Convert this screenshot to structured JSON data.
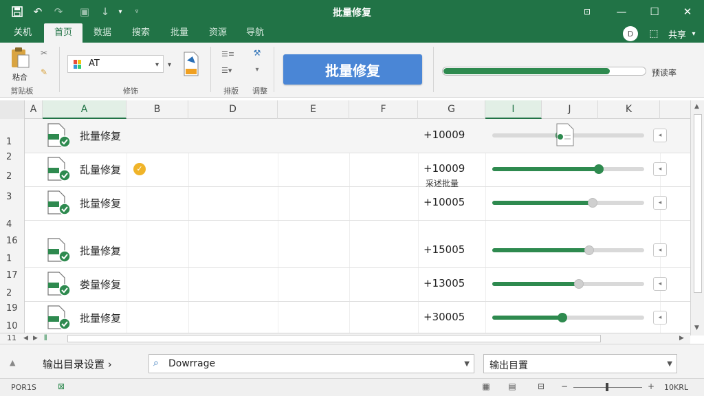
{
  "window": {
    "title": "批量修复"
  },
  "ribbon_tabs": [
    "关机",
    "首页",
    "数据",
    "搜索",
    "批量",
    "资源",
    "导航"
  ],
  "account": {
    "initial": "D",
    "label": "共享"
  },
  "ribbon": {
    "paste_label": "粘合",
    "group_clipboard": "剪贴板",
    "font_name": "AT",
    "group_font": "修饰",
    "group_list": "排版",
    "group_adjust": "调整",
    "big_button": "批量修复",
    "progress_percent": 82,
    "progress_label": "预读率"
  },
  "columns": [
    "A",
    "A",
    "B",
    "D",
    "E",
    "F",
    "G",
    "I",
    "J",
    "K"
  ],
  "row_headers": [
    {
      "top": "",
      "bottom": "1"
    },
    {
      "top": "2",
      "bottom": "2"
    },
    {
      "top": "3",
      "bottom": "4"
    },
    {
      "top": "16",
      "bottom": "1"
    },
    {
      "top": "17",
      "bottom": "2"
    },
    {
      "top": "19",
      "bottom": "10"
    },
    {
      "top": "11",
      "bottom": ""
    }
  ],
  "rows": [
    {
      "name": "批量修复",
      "num": "+10009",
      "slider": 0.45,
      "knob": "green",
      "badge": false
    },
    {
      "name": "乱量修复",
      "num": "+10009",
      "slider": 0.7,
      "knob": "green",
      "badge": true
    },
    {
      "name": "批量修复",
      "num": "+10005",
      "slider": 0.66,
      "knob": "grey",
      "badge": false,
      "note": "采述批量"
    },
    {
      "name": "批量修复",
      "num": "+15005",
      "slider": 0.64,
      "knob": "grey",
      "badge": false
    },
    {
      "name": "娄量修复",
      "num": "+13005",
      "slider": 0.57,
      "knob": "grey",
      "badge": false
    },
    {
      "name": "批量修复",
      "num": "+30005",
      "slider": 0.46,
      "knob": "green",
      "badge": false
    }
  ],
  "pathbar": {
    "label": "输出目录设置",
    "combo_value": "Dowrrage",
    "output_value": "输出目置"
  },
  "status": {
    "ready": "POR1S",
    "zoom": "10KRL"
  },
  "colors": {
    "brand": "#217346",
    "accent": "#4a86d6",
    "progress": "#2e8a4f",
    "badge": "#f0b429"
  }
}
